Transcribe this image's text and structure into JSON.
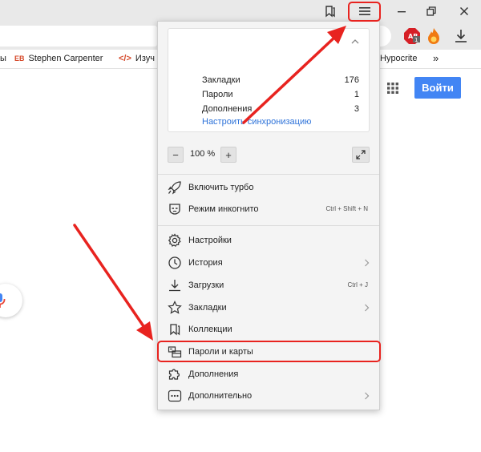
{
  "bookmarks_bar": {
    "items": [
      {
        "label": "ы"
      },
      {
        "badge": "EB",
        "label": "Stephen Carpenter"
      },
      {
        "label": "Изуч"
      },
      {
        "label": "Hypocrite"
      }
    ],
    "more_glyph": "»"
  },
  "page": {
    "login_label": "Войти"
  },
  "menu": {
    "sync": {
      "rows": [
        {
          "label": "Закладки",
          "count": "176"
        },
        {
          "label": "Пароли",
          "count": "1"
        },
        {
          "label": "Дополнения",
          "count": "3"
        }
      ],
      "link": "Настроить синхронизацию"
    },
    "zoom": {
      "minus": "−",
      "value": "100 %",
      "plus": "+"
    },
    "items": [
      {
        "label": "Включить турбо",
        "icon": "rocket-icon"
      },
      {
        "label": "Режим инкогнито",
        "shortcut": "Ctrl + Shift + N",
        "icon": "incognito-mask-icon"
      },
      {
        "label": "Настройки",
        "icon": "gear-icon"
      },
      {
        "label": "История",
        "icon": "clock-icon"
      },
      {
        "label": "Загрузки",
        "shortcut": "Ctrl + J",
        "icon": "download-icon"
      },
      {
        "label": "Закладки",
        "icon": "star-icon"
      },
      {
        "label": "Коллекции",
        "icon": "collections-icon"
      },
      {
        "label": "Пароли и карты",
        "icon": "key-card-icon"
      },
      {
        "label": "Дополнения",
        "icon": "puzzle-icon"
      },
      {
        "label": "Дополнительно",
        "icon": "more-dots-icon"
      }
    ]
  },
  "colors": {
    "annotation_red": "#e8231f",
    "login_blue": "#4285f4",
    "link_blue": "#2d72d9"
  }
}
